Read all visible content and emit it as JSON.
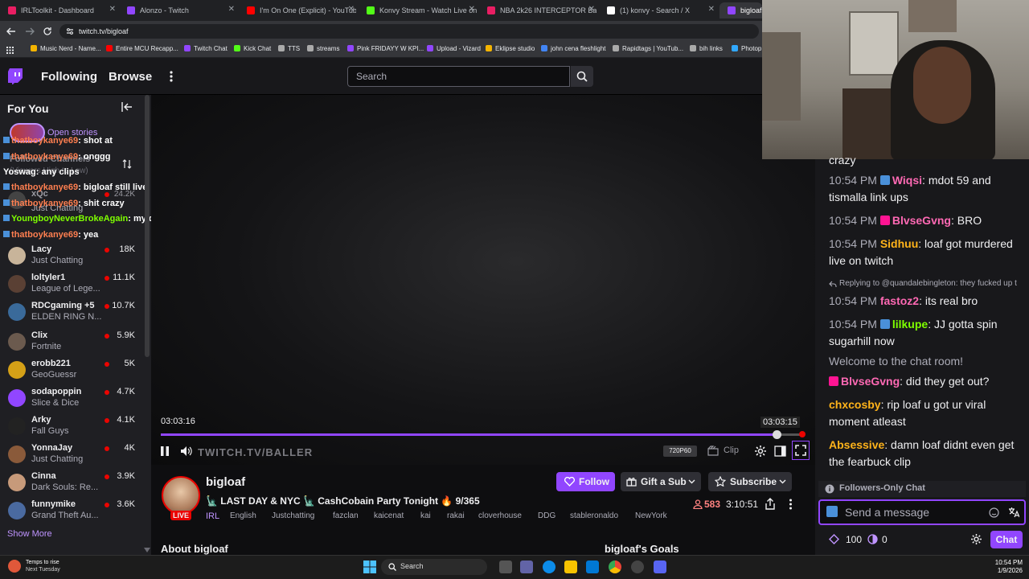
{
  "browser": {
    "tabs": [
      {
        "label": "IRLToolkit - Dashboard",
        "color": "#e91e63"
      },
      {
        "label": "Alonzo - Twitch",
        "color": "#9146ff"
      },
      {
        "label": "I'm On One (Explicit) - YouTube",
        "color": "#ff0000"
      },
      {
        "label": "Konvy Stream - Watch Live on",
        "color": "#53fc18"
      },
      {
        "label": "NBA 2k26 INTERCEPTOR Badge",
        "color": "#e91e63"
      },
      {
        "label": "(1) konvy - Search / X",
        "color": "#ffffff"
      },
      {
        "label": "bigloaf",
        "color": "#9146ff"
      }
    ],
    "url": "twitch.tv/bigloaf",
    "bookmarks": [
      {
        "label": "Music Nerd - Name...",
        "color": "#f4b400"
      },
      {
        "label": "Entire MCU Recapp...",
        "color": "#ff0000"
      },
      {
        "label": "Twitch Chat",
        "color": "#9146ff"
      },
      {
        "label": "Kick Chat",
        "color": "#53fc18"
      },
      {
        "label": "TTS",
        "color": "#aaaaaa"
      },
      {
        "label": "streams",
        "color": "#aaaaaa"
      },
      {
        "label": "Pink FRIDAYY W KPI...",
        "color": "#9146ff"
      },
      {
        "label": "Upload - Vizard",
        "color": "#9146ff"
      },
      {
        "label": "Eklipse studio",
        "color": "#f4b400"
      },
      {
        "label": "john cena fleshlight",
        "color": "#4285f4"
      },
      {
        "label": "Rapidtags | YouTub...",
        "color": "#aaaaaa"
      },
      {
        "label": "bih links",
        "color": "#aaaaaa"
      },
      {
        "label": "Photop",
        "color": "#31a8ff"
      }
    ]
  },
  "twitch_nav": {
    "following": "Following",
    "browse": "Browse",
    "search_placeholder": "Search"
  },
  "sidebar": {
    "for_you": "For You",
    "open_stories": "Open stories",
    "followed_channels_partial": "Followed Channels",
    "sort_partial": "(Viewers High to Low)",
    "xqc": {
      "name": "xQc",
      "viewers": "24.2K",
      "game": "Just Chatting"
    },
    "overlay_chat": [
      {
        "user": "thatboykanye69",
        "text": ": shot at",
        "color": "#ff7f50"
      },
      {
        "user": "thatboykanye69",
        "text": ": onggg",
        "color": "#ff7f50"
      },
      {
        "user": "Yoswag",
        "text": ": any clips",
        "color": "#ffffff"
      },
      {
        "user": "thatboykanye69",
        "text": ": bigloaf still live",
        "color": "#ff7f50"
      },
      {
        "user": "thatboykanye69",
        "text": ": shit crazy",
        "color": "#ff7f50"
      },
      {
        "user": "YoungboyNeverBrokeAgain",
        "text": ": my dam coin",
        "color": "#7fff00"
      },
      {
        "user": "thatboykanye69",
        "text": ": yea",
        "color": "#ff7f50"
      }
    ],
    "channels": [
      {
        "name": "Lacy",
        "game": "Just Chatting",
        "viewers": "18K",
        "color": "#c8b49a"
      },
      {
        "name": "loltyler1",
        "game": "League of Lege...",
        "viewers": "11.1K",
        "color": "#5a4034"
      },
      {
        "name": "RDCgaming +5",
        "game": "ELDEN RING N...",
        "viewers": "10.7K",
        "color": "#3a6a9a"
      },
      {
        "name": "Clix",
        "game": "Fortnite",
        "viewers": "5.9K",
        "color": "#6b5a4e"
      },
      {
        "name": "erobb221",
        "game": "GeoGuessr",
        "viewers": "5K",
        "color": "#d4a017"
      },
      {
        "name": "sodapoppin",
        "game": "Slice & Dice",
        "viewers": "4.7K",
        "color": "#9146ff"
      },
      {
        "name": "Arky",
        "game": "Fall Guys",
        "viewers": "4.1K",
        "color": "#222222"
      },
      {
        "name": "YonnaJay",
        "game": "Just Chatting",
        "viewers": "4K",
        "color": "#8a5a3a"
      },
      {
        "name": "Cinna",
        "game": "Dark Souls: Re...",
        "viewers": "3.9K",
        "color": "#c79a7a"
      },
      {
        "name": "funnymike",
        "game": "Grand Theft Au...",
        "viewers": "3.6K",
        "color": "#4a6aa0"
      }
    ],
    "show_more": "Show More"
  },
  "player": {
    "time_left": "03:03:16",
    "time_right": "03:03:15",
    "progress": 0.958,
    "watermark": "TWITCH.TV/BALLER",
    "quality": "720P60",
    "clip": "Clip"
  },
  "stream": {
    "channel": "bigloaf",
    "live": "LIVE",
    "title": "🗽 LAST DAY & NYC 🗽 CashCobain Party Tonight 🔥 9/365",
    "category": "IRL",
    "tags": [
      "English",
      "Justchatting",
      "fazclan",
      "kaicenat",
      "kai",
      "rakai",
      "cloverhouse",
      "DDG",
      "stableronaldo",
      "NewYork"
    ],
    "follow": "Follow",
    "gift": "Gift a Sub",
    "subscribe": "Subscribe",
    "viewers": "583",
    "uptime": "3:10:51",
    "about": "About bigloaf",
    "goals": "bigloaf's Goals"
  },
  "chat": {
    "partial_top": "crazy",
    "messages": [
      {
        "time": "10:54 PM",
        "user": "Wiqsi",
        "text": ": mdot 59 and tismalla link ups",
        "color": "#ff69b4",
        "badge": "#4a90d9"
      },
      {
        "time": "10:54 PM",
        "user": "BlvseGvng",
        "text": ": BRO",
        "color": "#ff69b4",
        "badge": "#ff1493"
      },
      {
        "time": "10:54 PM",
        "user": "Sidhuu",
        "text": ": loaf got murdered live on twitch",
        "color": "#ffb31a",
        "badge": ""
      },
      {
        "time": "10:54 PM",
        "user": "fastoz2",
        "text": ": its real bro",
        "color": "#ff69b4",
        "badge": ""
      },
      {
        "time": "10:54 PM",
        "user": "lilkupe",
        "text": ": JJ gotta spin sugarhill now",
        "color": "#7fff00",
        "badge": "#4a90d9"
      },
      {
        "time": "",
        "user": "BlvseGvng",
        "text": ": did they get out?",
        "color": "#ff69b4",
        "badge": "#ff1493"
      },
      {
        "time": "",
        "user": "chxcosby",
        "text": ": rip loaf u got ur viral moment atleast",
        "color": "#ffb31a",
        "badge": ""
      },
      {
        "time": "",
        "user": "Absessive",
        "text": ": damn loaf didnt even get the fearbuck clip",
        "color": "#ffb31a",
        "badge": ""
      }
    ],
    "reply_line": "Replying to @quandalebingleton: they fucked up t",
    "welcome": "Welcome to the chat room!",
    "followers_only": "Followers-Only Chat",
    "placeholder": "Send a message",
    "points": "100",
    "points2": "0",
    "chat_button": "Chat"
  },
  "taskbar": {
    "weather": "Temps to rise",
    "weather2": "Next Tuesday",
    "search": "Search",
    "time": "10:54 PM",
    "date": "1/9/2026"
  }
}
